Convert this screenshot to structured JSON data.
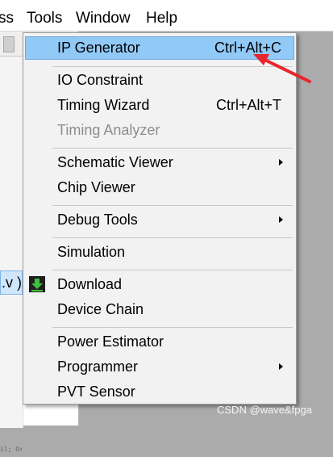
{
  "menubar": {
    "items": [
      "ss",
      "Tools",
      "Window",
      "Help"
    ]
  },
  "left_pane": {
    "file_item": ".v )",
    "bottom_text": "il; Ordr"
  },
  "tools_menu": {
    "items": [
      {
        "label": "IP Generator",
        "shortcut": "Ctrl+Alt+C",
        "highlighted": true
      },
      {
        "label": "IO Constraint"
      },
      {
        "label": "Timing Wizard",
        "shortcut": "Ctrl+Alt+T"
      },
      {
        "label": "Timing Analyzer",
        "disabled": true
      },
      {
        "label": "Schematic Viewer",
        "submenu": true
      },
      {
        "label": "Chip Viewer"
      },
      {
        "label": "Debug Tools",
        "submenu": true
      },
      {
        "label": "Simulation"
      },
      {
        "label": "Download",
        "icon": "download-green-arrow-icon"
      },
      {
        "label": "Device Chain"
      },
      {
        "label": "Power Estimator"
      },
      {
        "label": "Programmer",
        "submenu": true
      },
      {
        "label": "PVT Sensor"
      }
    ]
  },
  "annotation": {
    "arrow_color": "#e8262e"
  },
  "watermark": "CSDN @wave&fpga",
  "colors": {
    "highlight": "#91c9f7",
    "menu_bg": "#f2f2f2",
    "disabled_text": "#8d8d8d",
    "download_icon": "#2e9e2e"
  }
}
